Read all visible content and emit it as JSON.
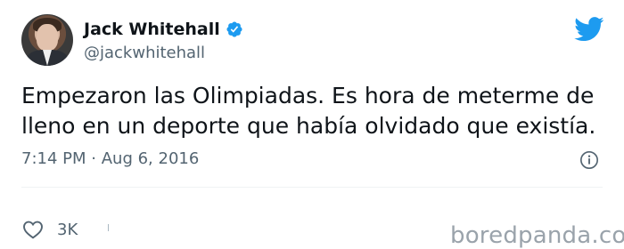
{
  "tweet": {
    "author": {
      "display_name": "Jack Whitehall",
      "handle": "@jackwhitehall",
      "verified": true,
      "avatar_icon": "profile-photo"
    },
    "text": "Empezaron las Olimpiadas. Es hora de meterme de\nlleno en un deporte que había olvidado que existía.",
    "time": "7:14 PM",
    "separator": "·",
    "date": "Aug 6, 2016",
    "likes": "3K",
    "platform_icon": "twitter-bird-icon"
  },
  "watermark": "boredpanda.com",
  "colors": {
    "accent": "#1d9bf0",
    "text": "#0f1419",
    "secondary": "#536471"
  }
}
